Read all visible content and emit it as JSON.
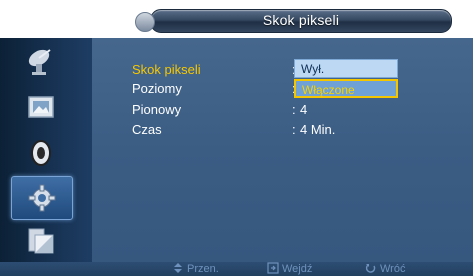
{
  "window": {
    "title": "Skok pikseli"
  },
  "sidebar": {
    "items": [
      {
        "icon": "satellite-dish-icon",
        "active": false
      },
      {
        "icon": "picture-frame-icon",
        "active": false
      },
      {
        "icon": "sound-icon",
        "active": false
      },
      {
        "icon": "gear-icon",
        "active": true
      },
      {
        "icon": "multi-screen-icon",
        "active": false
      }
    ]
  },
  "menu": {
    "rows": [
      {
        "label": "Skok pikseli",
        "value": ""
      },
      {
        "label": "Poziomy",
        "value": ""
      },
      {
        "label": "Pionowy",
        "value": "4"
      },
      {
        "label": "Czas",
        "value": "4 Min."
      }
    ],
    "colon": ":"
  },
  "dropdown": {
    "options": [
      "Wył.",
      "Włączone"
    ],
    "highlighted_index": 0,
    "selected_index": 1
  },
  "bottom_bar": {
    "move_label": "Przen.",
    "enter_label": "Wejdź",
    "return_label": "Wróć"
  },
  "colors": {
    "selected_text": "#f6c800",
    "panel_bg": "#3b5d84",
    "sidebar_bg": "#173253"
  }
}
